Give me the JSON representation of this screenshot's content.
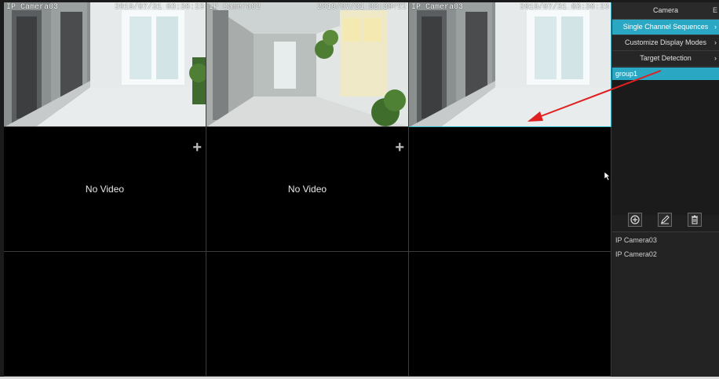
{
  "cameras": [
    {
      "label": "IP Camera03",
      "time": "2019/07/31 03:38:23"
    },
    {
      "label": "IP Camera02",
      "time": "2019/07/31 03:38:22"
    },
    {
      "label": "IP Camera03",
      "time": "2019/07/31 03:38:23"
    }
  ],
  "no_video": "No Video",
  "plus": "+",
  "panel": {
    "title": "Camera",
    "second_tab": "E",
    "menu": [
      {
        "label": "Single Channel Sequences",
        "arrow": "›"
      },
      {
        "label": "Customize Display Modes",
        "arrow": "›"
      },
      {
        "label": "Target Detection",
        "arrow": "›"
      }
    ],
    "group": "group1",
    "tools": [
      "add-icon",
      "edit-icon",
      "delete-icon"
    ],
    "camera_list": [
      "IP Camera03",
      "IP Camera02"
    ]
  },
  "colors": {
    "accent": "#2aa8c3",
    "annotation_arrow": "#e02020"
  }
}
